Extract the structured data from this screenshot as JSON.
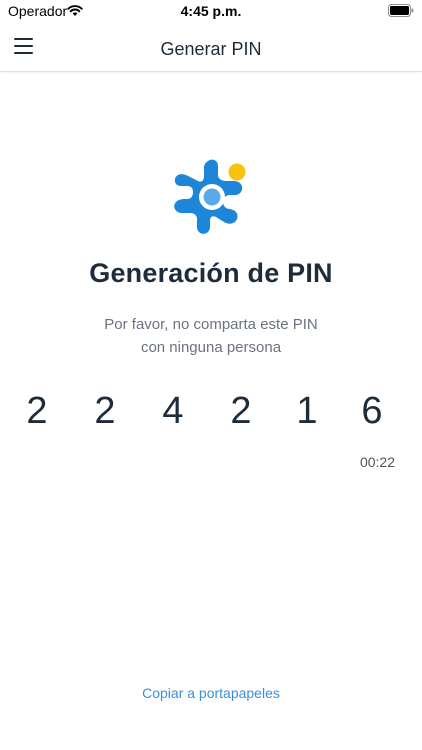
{
  "status_bar": {
    "carrier": "Operador",
    "time": "4:45 p.m.",
    "icons": [
      "wifi-icon",
      "battery-icon"
    ]
  },
  "nav": {
    "menu_icon": "hamburger-menu-icon",
    "title": "Generar PIN"
  },
  "logo": {
    "icon": "app-logo-icon",
    "colors": {
      "primary": "#1e86d8",
      "light": "#5aa9e6",
      "accent": "#f6c40f"
    }
  },
  "main": {
    "heading": "Generación de PIN",
    "subtitle_line1": "Por favor, no comparta este PIN",
    "subtitle_line2": "con ninguna persona",
    "pin_digits": [
      "2",
      "2",
      "4",
      "2",
      "1",
      "6"
    ],
    "countdown": "00:22"
  },
  "footer": {
    "copy_label": "Copiar a portapapeles"
  },
  "colors": {
    "text_dark": "#1d2b3a",
    "text_muted": "#6b7280",
    "link": "#3b8fd9"
  }
}
